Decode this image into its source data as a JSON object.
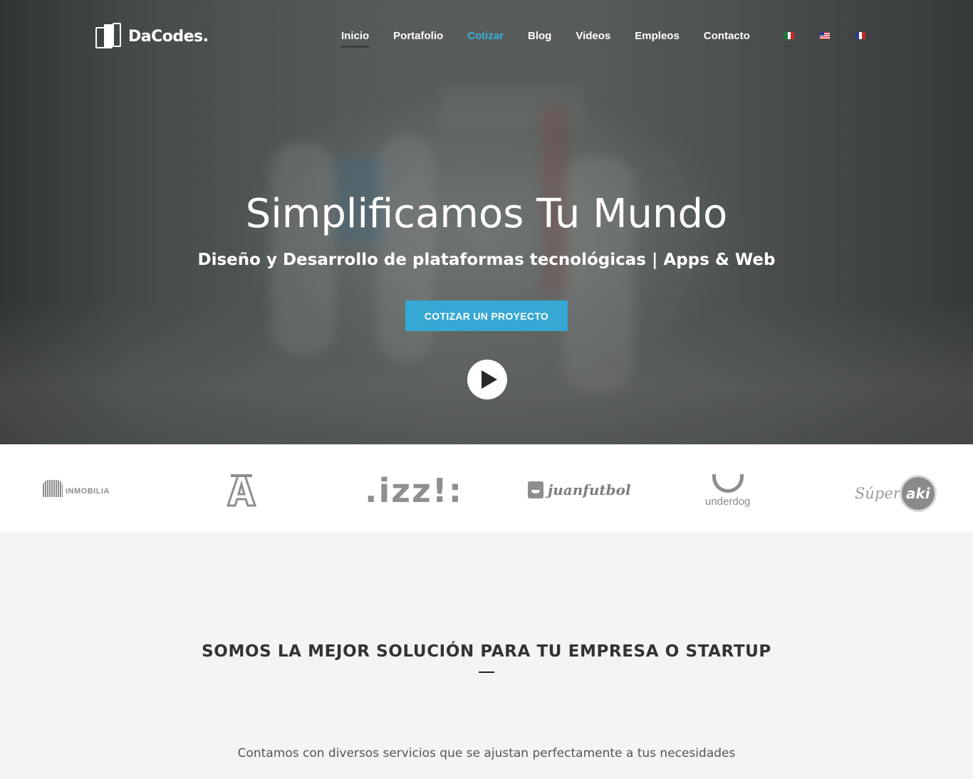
{
  "brand": {
    "name": "DaCodes."
  },
  "nav": {
    "items": [
      {
        "label": "Inicio",
        "active": true
      },
      {
        "label": "Portafolio"
      },
      {
        "label": "Cotizar",
        "accent": true
      },
      {
        "label": "Blog"
      },
      {
        "label": "Videos"
      },
      {
        "label": "Empleos"
      },
      {
        "label": "Contacto"
      }
    ],
    "languages": [
      "mexico-flag-icon",
      "usa-flag-icon",
      "france-flag-icon"
    ]
  },
  "hero": {
    "title": "Simplificamos Tu Mundo",
    "subtitle": "Diseño y Desarrollo de plataformas tecnológicas | Apps & Web",
    "cta_label": "COTIZAR UN PROYECTO",
    "play_icon": "play-icon"
  },
  "clients": {
    "logos": [
      "INMOBILIA",
      "A",
      ".izz!:",
      "juanfutbol",
      "underdog",
      "Súper",
      "aki"
    ]
  },
  "section": {
    "title": "SOMOS LA MEJOR SOLUCIÓN PARA TU EMPRESA O STARTUP",
    "description": "Contamos con diversos servicios que se ajustan perfectamente a tus necesidades"
  },
  "colors": {
    "accent": "#35a8d3",
    "white": "#ffffff",
    "section_bg": "#f4f4f4",
    "logo_gray": "#8d8d8d"
  }
}
